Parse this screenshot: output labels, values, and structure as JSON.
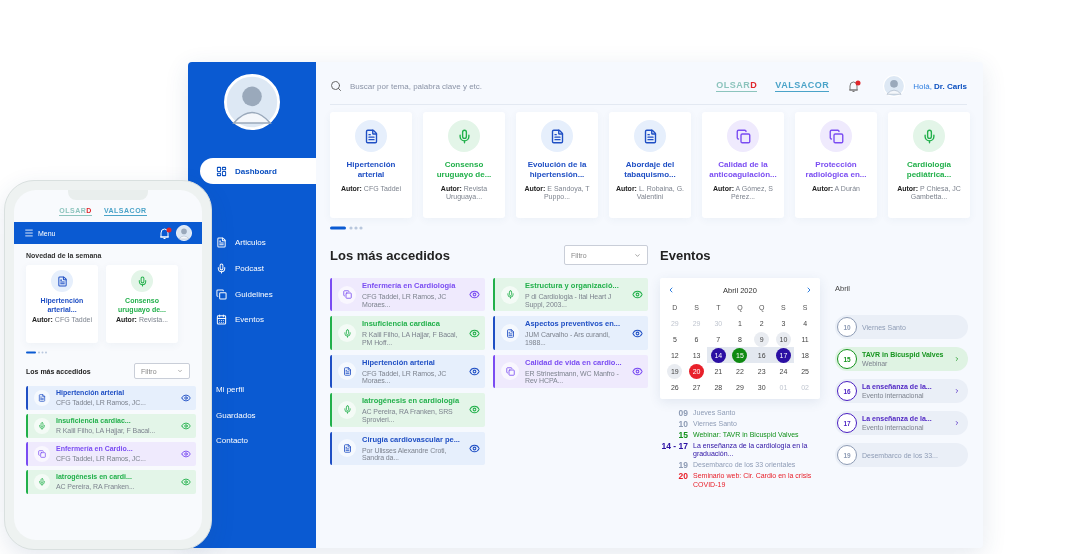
{
  "dashboard": {
    "sidebar": {
      "items": [
        {
          "label": "Dashboard",
          "selected": true
        },
        {
          "label": "Articulos",
          "selected": false
        },
        {
          "label": "Podcast",
          "selected": false
        },
        {
          "label": "Guidelines",
          "selected": false
        },
        {
          "label": "Eventos",
          "selected": false
        }
      ],
      "bottom_items": [
        "Mi perfil",
        "Guardados",
        "Contacto"
      ]
    },
    "search": {
      "placeholder": "Buscar por tema, palabra clave y etc."
    },
    "sponsors": [
      {
        "text": "OLSAR",
        "accent": "D"
      },
      {
        "text": "VALSACOR"
      }
    ],
    "greeting": "Holá, **Dr. Carls**",
    "featured": [
      {
        "title": "Hipertención arterial",
        "author": "**Autor:** CFG Taddei",
        "kind": "article"
      },
      {
        "title": "Consenso uruguayo de...",
        "author": "**Autor:** Revista Uruguaya...",
        "kind": "podcast"
      },
      {
        "title": "Evolución de la hipertensión...",
        "author": "**Autor:** E Sandoya, T Puppo...",
        "kind": "article"
      },
      {
        "title": "Abordaje del tabaquismo...",
        "author": "**Autor:** L. Robaina, G. Valentini",
        "kind": "article"
      },
      {
        "title": "Calidad de la anticoagulación...",
        "author": "**Autor:** A Gómez, S Pérez...",
        "kind": "guideline"
      },
      {
        "title": "Protección radiológica en...",
        "author": "**Autor:** A Durán",
        "kind": "guideline"
      },
      {
        "title": "Cardiología pediátrica...",
        "author": "**Autor:** P Chiesa, JC Gambetta...",
        "kind": "podcast"
      }
    ],
    "most_accessed": {
      "title": "Los más accedidos",
      "filter": {
        "placeholder": "Filtro"
      },
      "columns": [
        [
          {
            "title": "Enfermería en Cardiología",
            "authors": "CFG Taddei, LR Ramos, JC Moraes...",
            "kind": "guideline"
          },
          {
            "title": "Insuficiencia cardiaca",
            "authors": "R Kalil Filho, LA Hajjar, F Bacal, PM Hoff...",
            "kind": "podcast"
          },
          {
            "title": "Hipertención arterial",
            "authors": "CFG Taddei, LR Ramos, JC Moraes...",
            "kind": "article"
          },
          {
            "title": "Iatrogénesis en cardiología",
            "authors": "AC Pereira, RA Franken, SRS Sprovieri...",
            "kind": "podcast"
          },
          {
            "title": "Cirugía cardiovascular pe...",
            "authors": "Por Ulisses Alexandre Croti, Sandra da...",
            "kind": "article"
          }
        ],
        [
          {
            "title": "Estructura y organizació...",
            "authors": "P di Cardiologia - Ital Heart J Suppl, 2003...",
            "kind": "podcast"
          },
          {
            "title": "Aspectos preventivos en...",
            "authors": "JUM Carvalho - Ars curandi, 1988...",
            "kind": "article"
          },
          {
            "title": "Calidad de vida en cardio...",
            "authors": "ER Strinestmann, WC Manfro - Rev HCPA...",
            "kind": "guideline"
          }
        ]
      ]
    },
    "events": {
      "title": "Eventos",
      "calendar": {
        "month": "Abril 2020",
        "weekdays": [
          "D",
          "S",
          "T",
          "Q",
          "Q",
          "S",
          "S"
        ],
        "days": [
          {
            "label": "29",
            "muted": true
          },
          {
            "label": "29",
            "muted": true
          },
          {
            "label": "30",
            "muted": true
          },
          {
            "label": "1",
            "muted": false
          },
          {
            "label": "2",
            "muted": false
          },
          {
            "label": "3",
            "muted": false
          },
          {
            "label": "4",
            "muted": false
          },
          {
            "label": "5",
            "muted": false
          },
          {
            "label": "6",
            "muted": false
          },
          {
            "label": "7",
            "muted": false
          },
          {
            "label": "8",
            "muted": false
          },
          {
            "label": "9",
            "muted": false,
            "color": "#e9ecf1"
          },
          {
            "label": "10",
            "muted": false,
            "color": "#e9ecf1"
          },
          {
            "label": "11",
            "muted": false
          },
          {
            "label": "12",
            "muted": false
          },
          {
            "label": "13",
            "muted": false
          },
          {
            "label": "14",
            "muted": false,
            "color": "#2b0fa3",
            "in_range": true
          },
          {
            "label": "15",
            "muted": false,
            "color": "#0f8a12",
            "in_range": true
          },
          {
            "label": "16",
            "muted": false,
            "in_range": true
          },
          {
            "label": "17",
            "muted": false,
            "color": "#2b0fa3",
            "in_range": true
          },
          {
            "label": "18",
            "muted": false
          },
          {
            "label": "19",
            "muted": false,
            "color": "#e9ecf1"
          },
          {
            "label": "20",
            "muted": false,
            "color": "#e8202a"
          },
          {
            "label": "21",
            "muted": false
          },
          {
            "label": "22",
            "muted": false
          },
          {
            "label": "23",
            "muted": false
          },
          {
            "label": "24",
            "muted": false
          },
          {
            "label": "25",
            "muted": false
          },
          {
            "label": "26",
            "muted": false
          },
          {
            "label": "27",
            "muted": false
          },
          {
            "label": "28",
            "muted": false
          },
          {
            "label": "29",
            "muted": false
          },
          {
            "label": "30",
            "muted": false
          },
          {
            "label": "01",
            "muted": true
          },
          {
            "label": "02",
            "muted": true
          }
        ]
      },
      "legend": [
        {
          "date": "09",
          "text": "Jueves Santo",
          "color": "#8e9cb5"
        },
        {
          "date": "10",
          "text": "Viernes Santo",
          "color": "#8e9cb5"
        },
        {
          "date": "15",
          "text": "Webinar: TAVR in Bicuspid Valves",
          "color": "#11911a"
        },
        {
          "date": "14 - 17",
          "text": "La enseñanza de la cardiología en la graduación...",
          "color": "#2b0fa3"
        },
        {
          "date": "19",
          "text": "Desembarco de los 33 orientales",
          "color": "#8e9cb5"
        },
        {
          "date": "20",
          "text": "Seminario web: Cir. Cardio en la crisis COVID-19",
          "color": "#e8202a"
        }
      ],
      "month_label": "Abril",
      "agenda": [
        {
          "day": "10",
          "title": "Viernes Santo",
          "color": "#8e9cb5",
          "selected": false
        },
        {
          "day": "15",
          "title": "TAVR in Bicuspid Valves",
          "subtitle": "Webinar",
          "color": "#15941e",
          "selected": true
        },
        {
          "day": "16",
          "title": "La enseñanza de la...",
          "subtitle": "Evento internacional",
          "color": "#4a1fc2",
          "selected": false
        },
        {
          "day": "17",
          "title": "La enseñanza de la...",
          "subtitle": "Evento internacional",
          "color": "#4a1fc2",
          "selected": false
        },
        {
          "day": "19",
          "title": "Desembarco de los 33...",
          "color": "#8e9cb5",
          "selected": false
        }
      ]
    }
  },
  "phone": {
    "sponsors": [
      {
        "text": "OLSAR",
        "accent": "D"
      },
      {
        "text": "VALSACOR"
      }
    ],
    "menu_label": "Menu",
    "week_title": "Novedad de la semana",
    "featured": [
      {
        "title": "Hipertención arterial...",
        "author": "**Autor:** CFG Taddei",
        "kind": "article"
      },
      {
        "title": "Consenso uruguayo de...",
        "author": "**Autor:** Revista...",
        "kind": "podcast"
      }
    ],
    "most_accessed": {
      "title": "Los más accedidos",
      "filter": {
        "placeholder": "Filtro"
      },
      "items": [
        {
          "title": "Hipertención arterial",
          "authors": "CFG Taddei, LR Ramos, JC...",
          "kind": "article"
        },
        {
          "title": "Insuficiencia cardiac...",
          "authors": "R Kalil Filho, LA Hajjar, F Bacal...",
          "kind": "podcast"
        },
        {
          "title": "Enfermería en Cardio...",
          "authors": "CFG Taddei, LR Ramos, JC...",
          "kind": "guideline"
        },
        {
          "title": "Iatrogénesis en cardi...",
          "authors": "AC Pereira, RA Franken...",
          "kind": "podcast"
        }
      ]
    }
  }
}
